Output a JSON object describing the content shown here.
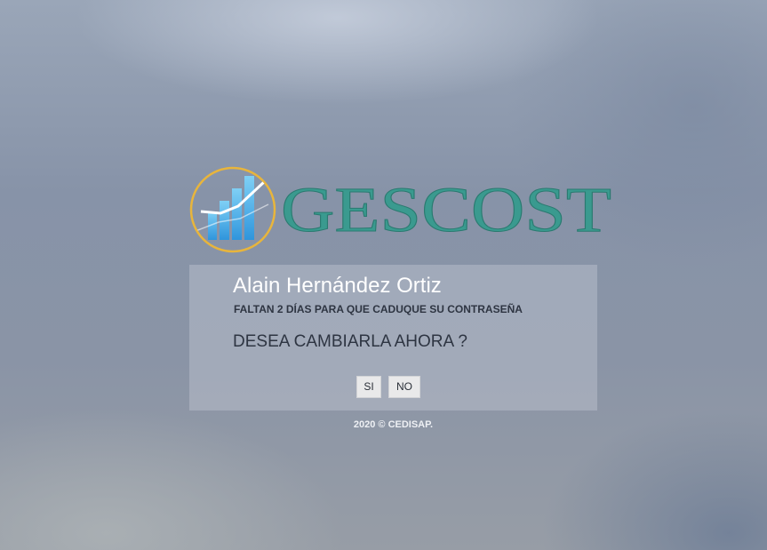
{
  "logo": {
    "brand_text": "GESCOST",
    "icon": "bar-chart-icon",
    "ring_color": "#e8b53c",
    "text_color": "#3a9a8f"
  },
  "dialog": {
    "user_name": "Alain Hernández Ortiz",
    "warning": "FALTAN 2 DÍAS PARA QUE CADUQUE SU CONTRASEÑA",
    "question": "DESEA CAMBIARLA AHORA ?",
    "yes_label": "SI",
    "no_label": "NO"
  },
  "footer": {
    "text": "2020 © CEDISAP."
  }
}
